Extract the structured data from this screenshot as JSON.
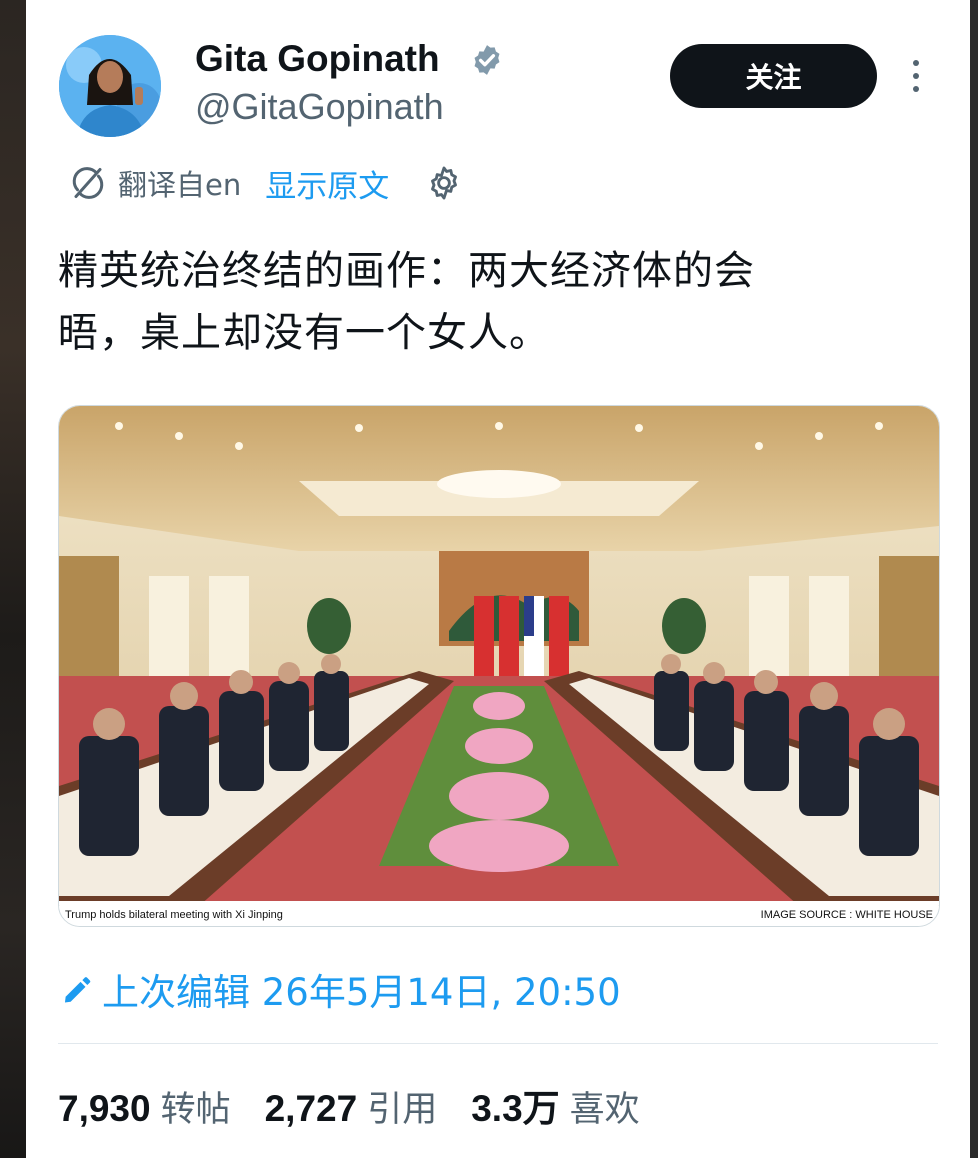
{
  "author": {
    "display_name": "Gita Gopinath",
    "handle": "@GitaGopinath"
  },
  "actions": {
    "follow_label": "关注"
  },
  "translation": {
    "translated_from": "翻译自en",
    "show_original": "显示原文"
  },
  "post": {
    "text_line1": "精英统治终结的画作：两大经济体的会",
    "text_line2": "晤，桌上却没有一个女人。",
    "media_caption_left": "Trump holds bilateral meeting with Xi Jinping",
    "media_caption_right": "IMAGE SOURCE : WHITE HOUSE",
    "edited_text": "上次编辑 26年5月14日, 20:50"
  },
  "stats": [
    {
      "value": "7,930",
      "label": "转帖"
    },
    {
      "value": "2,727",
      "label": "引用"
    },
    {
      "value": "3.3万",
      "label": "喜欢"
    }
  ],
  "colors": {
    "link_blue": "#1d9bf0",
    "text_primary": "#0f1419",
    "text_secondary": "#536471",
    "follow_button_bg": "#0f1419"
  },
  "icons": [
    "verified-badge-icon",
    "more-options-icon",
    "translate-icon",
    "settings-gear-icon",
    "edit-pencil-icon"
  ]
}
